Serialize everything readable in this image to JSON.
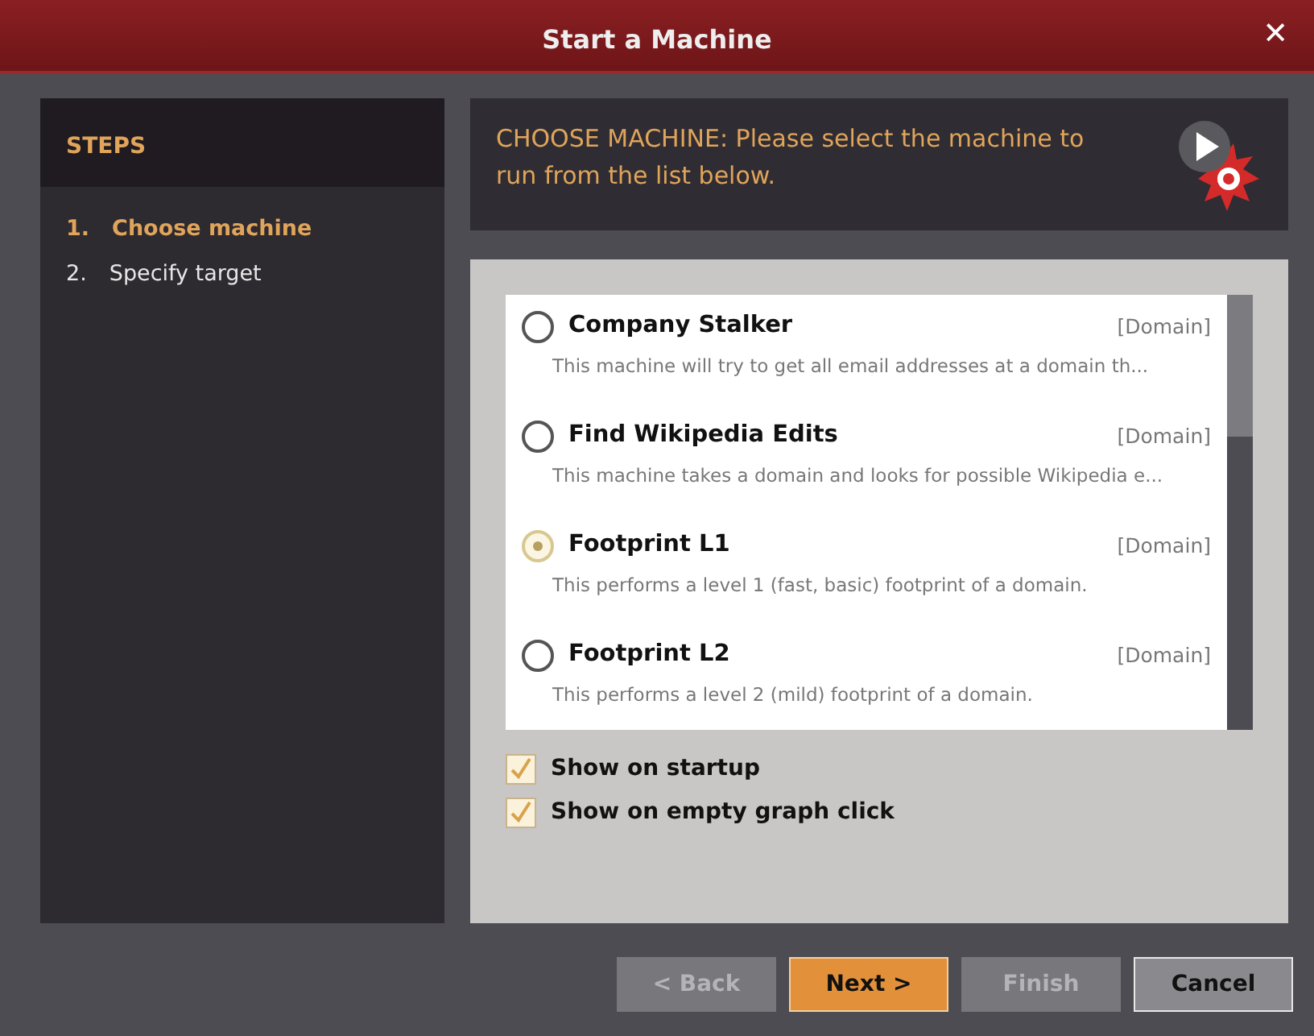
{
  "window": {
    "title": "Start a Machine",
    "close": "✕"
  },
  "steps": {
    "title": "STEPS",
    "items": [
      {
        "number": "1.",
        "label": "Choose machine",
        "selected": true
      },
      {
        "number": "2.",
        "label": "Specify target",
        "selected": false
      }
    ]
  },
  "header": {
    "text": "CHOOSE MACHINE: Please select the machine to run from the list below."
  },
  "machines": [
    {
      "name": "Company Stalker",
      "type": "[Domain]",
      "description": "This machine will try to get all email addresses at a domain th...",
      "selected": false
    },
    {
      "name": "Find Wikipedia Edits",
      "type": "[Domain]",
      "description": "This machine takes a domain and looks for possible Wikipedia e...",
      "selected": false
    },
    {
      "name": "Footprint L1",
      "type": "[Domain]",
      "description": "This performs a level 1 (fast, basic) footprint of a domain.",
      "selected": true
    },
    {
      "name": "Footprint L2",
      "type": "[Domain]",
      "description": "This performs a level 2 (mild) footprint of a domain.",
      "selected": false
    }
  ],
  "options": [
    {
      "label": "Show on startup",
      "checked": true
    },
    {
      "label": "Show on empty graph click",
      "checked": true
    }
  ],
  "buttons": [
    {
      "label": "< Back",
      "kind": "normal",
      "disabled": true
    },
    {
      "label": "Next >",
      "kind": "primary",
      "disabled": false
    },
    {
      "label": "Finish",
      "kind": "normal",
      "disabled": true
    },
    {
      "label": "Cancel",
      "kind": "normal",
      "disabled": false
    }
  ]
}
